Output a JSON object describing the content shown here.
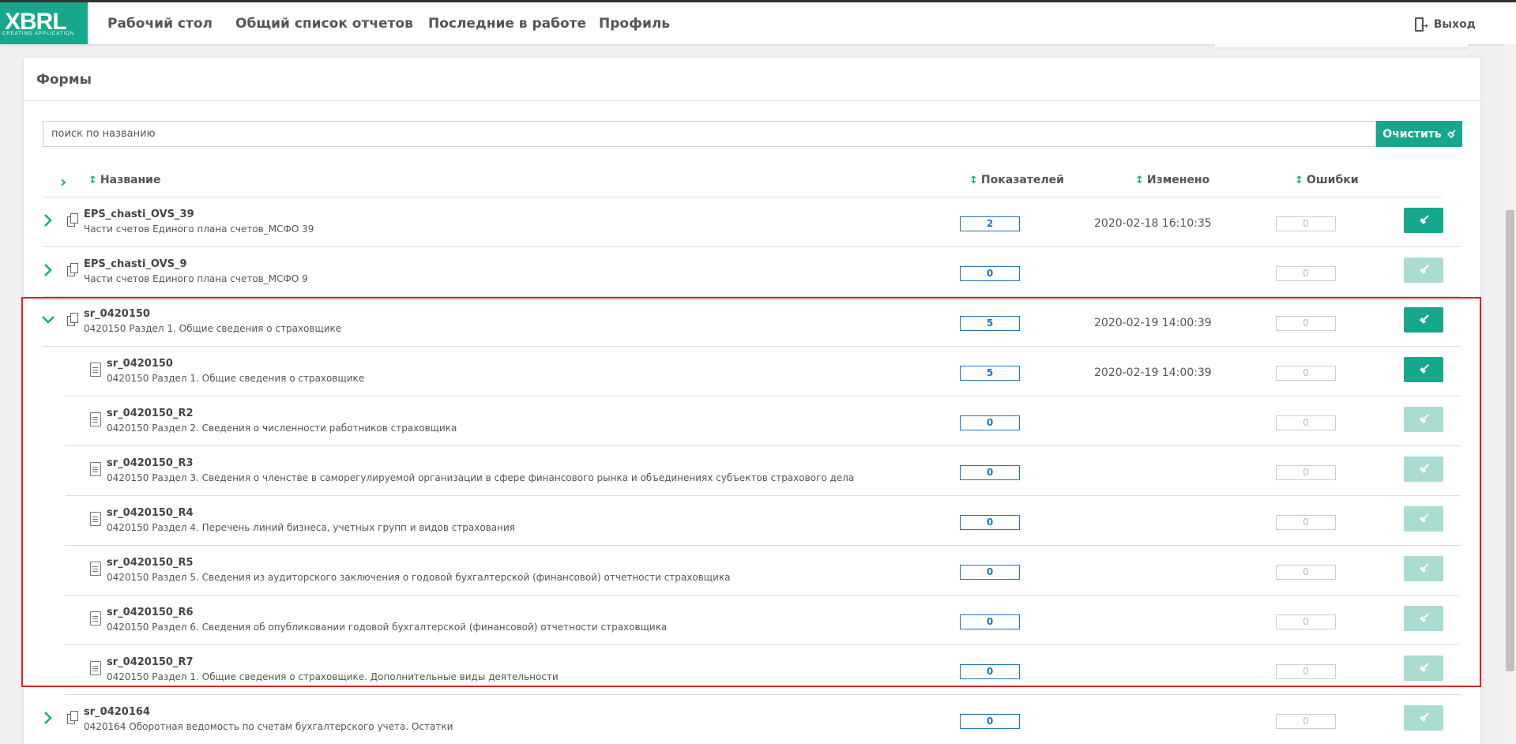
{
  "logo": {
    "text": "XBRL",
    "tagline": "CREATING APPLICATION"
  },
  "nav": {
    "items": [
      "Рабочий стол",
      "Общий список отчетов",
      "Последние в работе",
      "Профиль"
    ],
    "logout": "Выход"
  },
  "panel": {
    "title": "Формы",
    "search_placeholder": "поиск по названию",
    "clear_label": "Очистить"
  },
  "table": {
    "headers": {
      "name": "Название",
      "indicators": "Показателей",
      "modified": "Изменено",
      "errors": "Ошибки"
    },
    "rows": [
      {
        "name": "EPS_chasti_OVS_39",
        "desc": "Части счетов Единого плана счетов_МСФО 39",
        "count": "2",
        "date": "2020-02-18 16:10:35",
        "errors": "0",
        "active": true
      },
      {
        "name": "EPS_chasti_OVS_9",
        "desc": "Части счетов Единого плана счетов_МСФО 9",
        "count": "0",
        "date": "",
        "errors": "0",
        "active": false
      },
      {
        "name": "sr_0420150",
        "desc": "0420150 Раздел 1. Общие сведения о страховщике",
        "count": "5",
        "date": "2020-02-19 14:00:39",
        "errors": "0",
        "active": true
      },
      {
        "name": "sr_0420150",
        "desc": "0420150 Раздел 1. Общие сведения о страховщике",
        "count": "5",
        "date": "2020-02-19 14:00:39",
        "errors": "0",
        "active": true
      },
      {
        "name": "sr_0420150_R2",
        "desc": "0420150 Раздел 2. Сведения о численности работников страховщика",
        "count": "0",
        "date": "",
        "errors": "0",
        "active": false
      },
      {
        "name": "sr_0420150_R3",
        "desc": "0420150 Раздел 3. Сведения о членстве в саморегулируемой организации в сфере финансового рынка и объединениях субъектов страхового дела",
        "count": "0",
        "date": "",
        "errors": "0",
        "active": false
      },
      {
        "name": "sr_0420150_R4",
        "desc": "0420150 Раздел 4. Перечень линий бизнеса, учетных групп и видов страхования",
        "count": "0",
        "date": "",
        "errors": "0",
        "active": false
      },
      {
        "name": "sr_0420150_R5",
        "desc": "0420150 Раздел 5. Сведения из аудиторского заключения о годовой бухгалтерской (финансовой) отчетности страховщика",
        "count": "0",
        "date": "",
        "errors": "0",
        "active": false
      },
      {
        "name": "sr_0420150_R6",
        "desc": "0420150 Раздел 6. Сведения об опубликовании годовой бухгалтерской (финансовой) отчетности страховщика",
        "count": "0",
        "date": "",
        "errors": "0",
        "active": false
      },
      {
        "name": "sr_0420150_R7",
        "desc": "0420150 Раздел 1. Общие сведения о страховщике. Дополнительные виды деятельности",
        "count": "0",
        "date": "",
        "errors": "0",
        "active": false
      },
      {
        "name": "sr_0420164",
        "desc": "0420164 Оборотная ведомость по счетам бухгалтерского учета. Остатки",
        "count": "0",
        "date": "",
        "errors": "0",
        "active": false
      }
    ]
  },
  "colors": {
    "accent": "#16a88a",
    "accent_disabled": "#a9ddd1",
    "count_border": "#1e73be",
    "highlight": "#e02020"
  }
}
